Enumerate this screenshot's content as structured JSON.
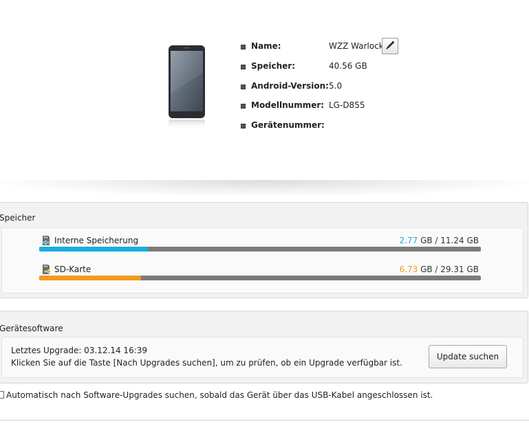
{
  "device": {
    "name_label": "Name:",
    "name_value": "WZZ Warlock",
    "storage_label": "Speicher:",
    "storage_value": "40.56 GB",
    "android_label": "Android-Version:",
    "android_value": "5.0",
    "model_label": "Modellnummer:",
    "model_value": "LG-D855",
    "serial_label": "Gerätenummer:",
    "serial_value": ""
  },
  "icons": {
    "phone": "phone-image",
    "edit": "pencil-icon",
    "bullet": "square-bullet-icon",
    "internal": "internal-storage-icon",
    "sd": "sd-card-icon"
  },
  "storage": {
    "title": "Speicher",
    "internal": {
      "label": "Interne Speicherung",
      "used": "2.77",
      "unit": "GB",
      "separator": "/",
      "total": "11.24 GB",
      "fraction": 0.246,
      "color": "#1aaee0"
    },
    "sd": {
      "label": "SD-Karte",
      "used": "6.73",
      "unit": "GB",
      "separator": "/",
      "total": "29.31 GB",
      "fraction": 0.23,
      "color": "#f29b1d"
    }
  },
  "software": {
    "title": "Gerätesoftware",
    "last_upgrade": "Letztes Upgrade: 03.12.14 16:39",
    "instruction": "Klicken Sie auf die Taste [Nach Upgrades suchen], um zu prüfen, ob ein Upgrade verfügbar ist.",
    "update_button": "Update suchen"
  },
  "auto_check": {
    "checked": false,
    "label": "Automatisch nach Software-Upgrades suchen, sobald das Gerät über das USB-Kabel angeschlossen ist."
  }
}
